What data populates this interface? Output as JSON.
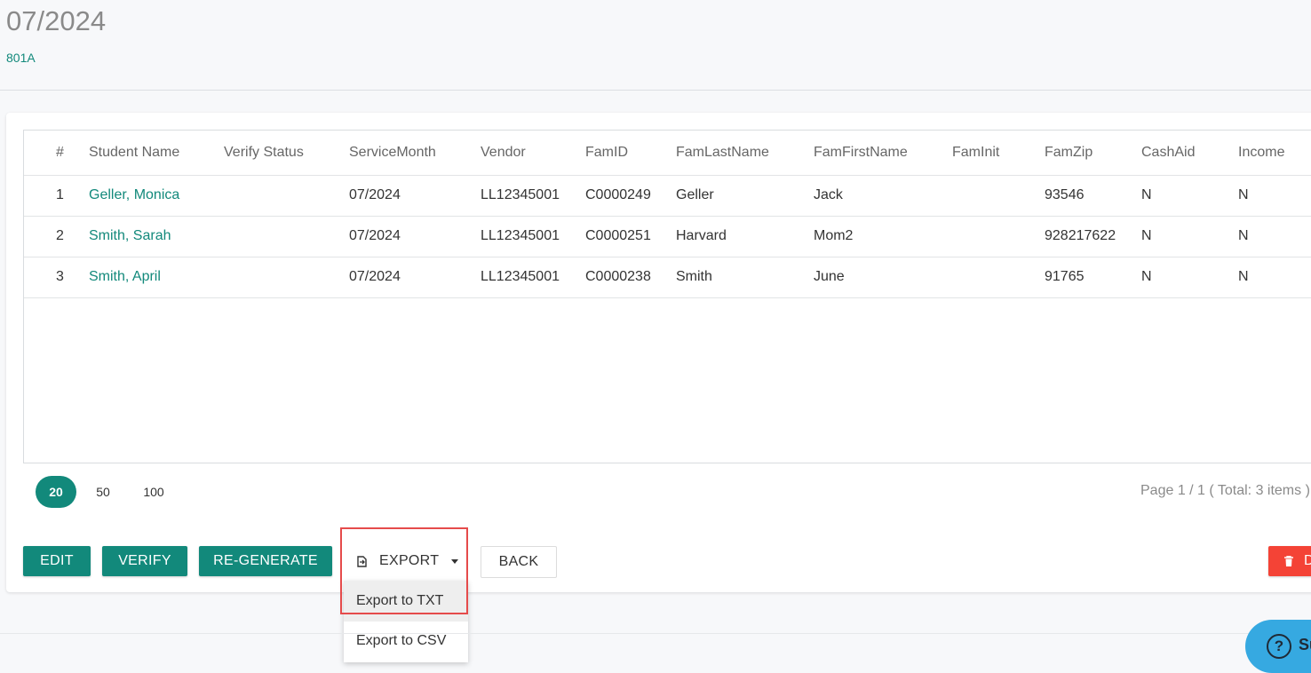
{
  "header": {
    "title": "07/2024",
    "subtitle": "801A"
  },
  "table": {
    "columns": [
      "#",
      "Student Name",
      "Verify Status",
      "ServiceMonth",
      "Vendor",
      "FamID",
      "FamLastName",
      "FamFirstName",
      "FamInit",
      "FamZip",
      "CashAid",
      "Income"
    ],
    "rows": [
      [
        "1",
        "Geller, Monica",
        "",
        "07/2024",
        "LL12345001",
        "C0000249",
        "Geller",
        "Jack",
        "",
        "93546",
        "N",
        "N"
      ],
      [
        "2",
        "Smith, Sarah",
        "",
        "07/2024",
        "LL12345001",
        "C0000251",
        "Harvard",
        "Mom2",
        "",
        "928217622",
        "N",
        "N"
      ],
      [
        "3",
        "Smith, April",
        "",
        "07/2024",
        "LL12345001",
        "C0000238",
        "Smith",
        "June",
        "",
        "91765",
        "N",
        "N"
      ]
    ]
  },
  "pager": {
    "sizes": [
      "20",
      "50",
      "100"
    ],
    "selected": "20",
    "info": "Page 1 / 1 ( Total: 3 items )"
  },
  "toolbar": {
    "edit": "EDIT",
    "verify": "VERIFY",
    "regenerate": "RE-GENERATE",
    "export": "EXPORT",
    "back": "BACK",
    "delete": "DELETE"
  },
  "export_menu": {
    "items": [
      "Export to TXT",
      "Export to CSV"
    ],
    "highlighted": "Export to TXT"
  },
  "help": {
    "label": "Support"
  },
  "colors": {
    "accent": "#12897b",
    "danger": "#f44336",
    "highlight": "#e54b4b",
    "help": "#36a9e1"
  },
  "icons": {
    "export": "file-export-icon",
    "dropdown": "caret-down-icon",
    "delete": "trash-icon",
    "help": "question-circle-icon"
  }
}
